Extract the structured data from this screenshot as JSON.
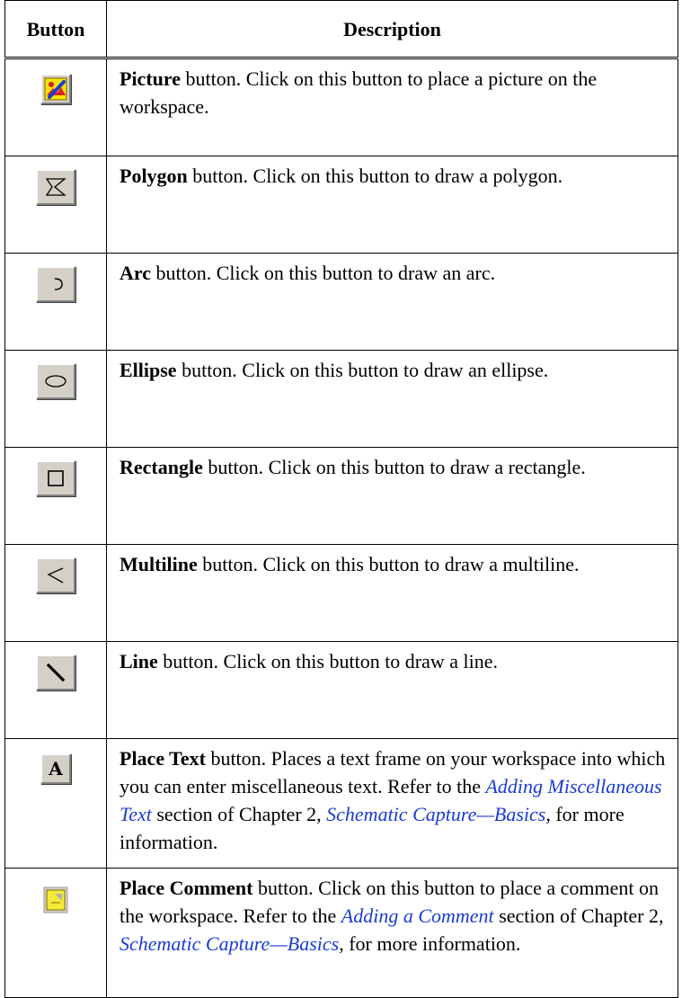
{
  "table": {
    "headers": {
      "button": "Button",
      "description": "Description"
    },
    "rows": [
      {
        "icon": "picture-icon",
        "name": "Picture",
        "text": " button. Click on this button to place a picture on the workspace."
      },
      {
        "icon": "polygon-icon",
        "name": "Polygon",
        "text": " button. Click on this button to draw a polygon."
      },
      {
        "icon": "arc-icon",
        "name": "Arc",
        "text": " button. Click on this button to draw an arc."
      },
      {
        "icon": "ellipse-icon",
        "name": "Ellipse",
        "text": " button. Click on this button to draw an ellipse."
      },
      {
        "icon": "rectangle-icon",
        "name": "Rectangle",
        "text": " button. Click on this button to draw a rectangle."
      },
      {
        "icon": "multiline-icon",
        "name": "Multiline",
        "text": " button. Click on this button to draw a multiline."
      },
      {
        "icon": "line-icon",
        "name": "Line",
        "text": " button. Click on this button to draw a line."
      },
      {
        "icon": "place-text-icon",
        "name": "Place Text",
        "text": " button. Places a text frame on your workspace into which you can enter miscellaneous text. Refer to the ",
        "link1": "Adding Miscellaneous Text",
        "mid": " section of Chapter 2, ",
        "link2": "Schematic Capture—Basics",
        "end": ", for more information."
      },
      {
        "icon": "place-comment-icon",
        "name": "Place Comment",
        "text": " button. Click on this button to place a comment on the workspace. Refer to the ",
        "link1": "Adding a Comment",
        "mid": " section of Chapter 2, ",
        "link2": "Schematic Capture—Basics",
        "end": ", for more information."
      }
    ],
    "icon_glyph": {
      "place_text": "A"
    }
  },
  "colors": {
    "link": "#1a3bd6",
    "button_face": "#d4d0c8"
  }
}
